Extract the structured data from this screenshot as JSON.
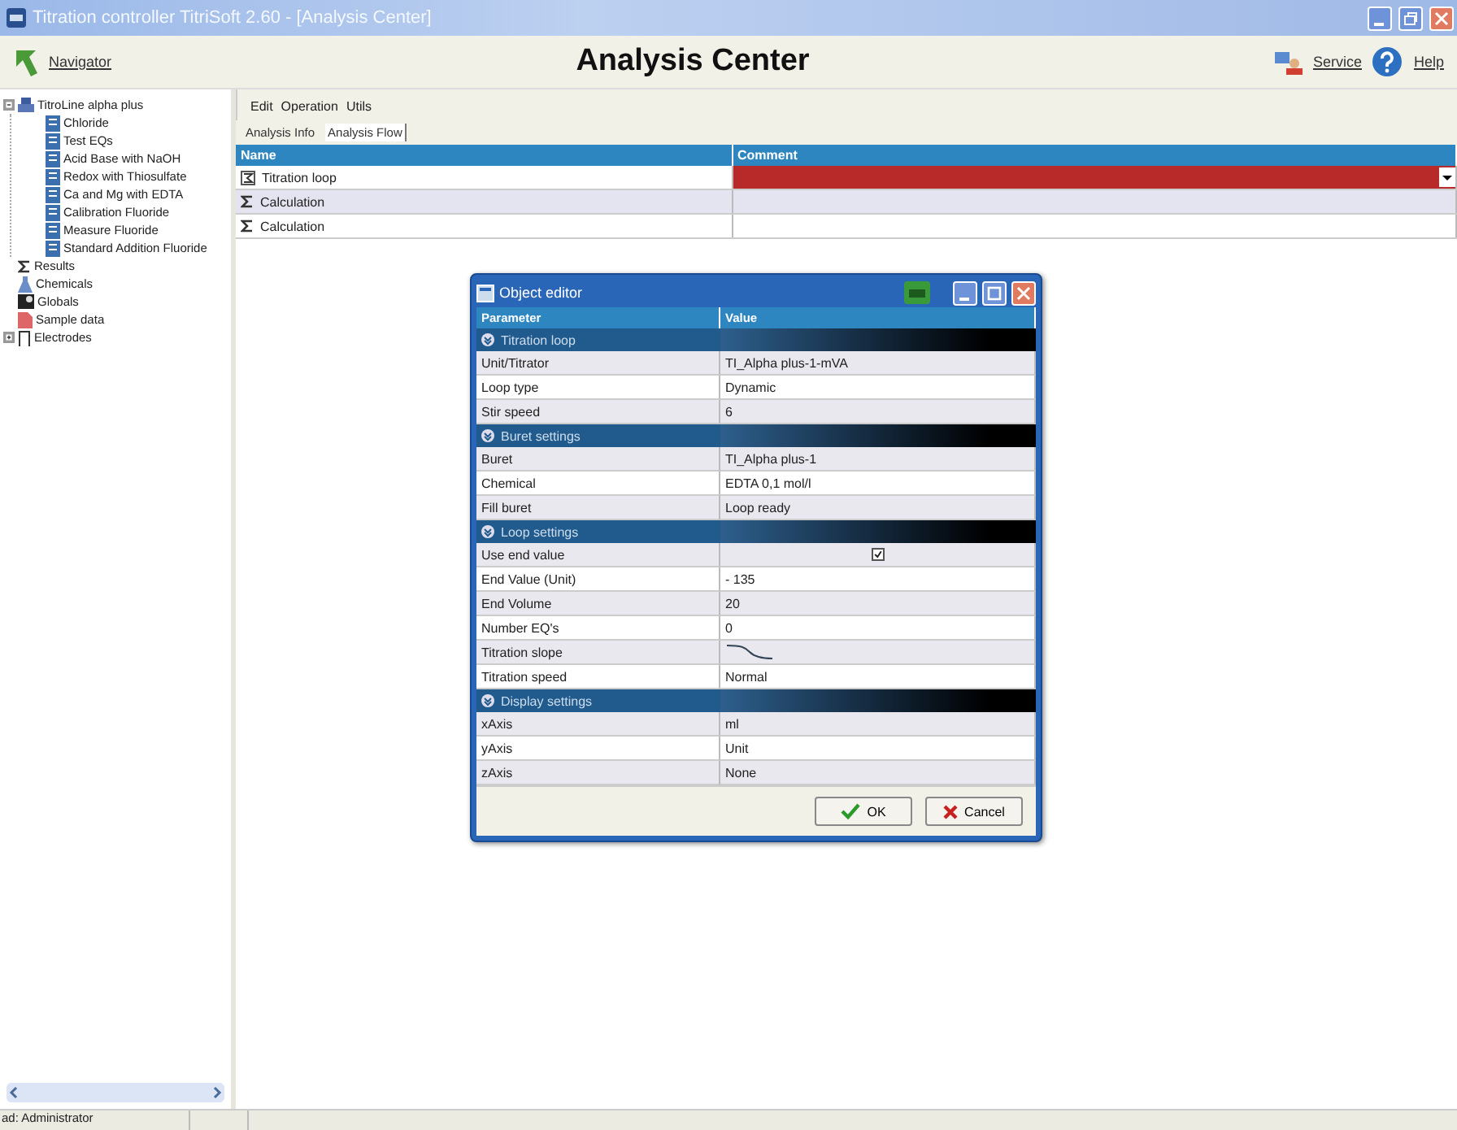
{
  "window": {
    "title": "Titration controller TitriSoft 2.60 - [Analysis Center]"
  },
  "header": {
    "navigator": "Navigator",
    "title": "Analysis Center",
    "service": "Service",
    "help": "Help"
  },
  "tree": [
    {
      "label": "TitroLine alpha plus",
      "kind": "device",
      "expanded": true,
      "children": [
        {
          "label": "Chloride",
          "kind": "method"
        },
        {
          "label": "Test EQs",
          "kind": "method"
        },
        {
          "label": "Acid Base with NaOH",
          "kind": "method"
        },
        {
          "label": "Redox with Thiosulfate",
          "kind": "method"
        },
        {
          "label": "Ca and Mg with EDTA",
          "kind": "method"
        },
        {
          "label": "Calibration Fluoride",
          "kind": "method"
        },
        {
          "label": "Measure Fluoride",
          "kind": "method"
        },
        {
          "label": "Standard Addition Fluoride",
          "kind": "method"
        }
      ]
    },
    {
      "label": "Results",
      "kind": "sigma"
    },
    {
      "label": "Chemicals",
      "kind": "flask"
    },
    {
      "label": "Globals",
      "kind": "globe"
    },
    {
      "label": "Sample data",
      "kind": "sample"
    },
    {
      "label": "Electrodes",
      "kind": "electrode",
      "expanded": false
    }
  ],
  "menu": [
    "Edit",
    "Operation",
    "Utils"
  ],
  "tabs": [
    {
      "label": "Analysis Info",
      "selected": false
    },
    {
      "label": "Analysis Flow",
      "selected": true
    }
  ],
  "table": {
    "columns": [
      "Name",
      "Comment"
    ],
    "rows": [
      {
        "name": "Titration loop",
        "kind": "loop",
        "editing": true
      },
      {
        "name": "Calculation",
        "kind": "sigma",
        "editing": false
      },
      {
        "name": "Calculation",
        "kind": "sigma",
        "editing": false
      }
    ]
  },
  "dialog": {
    "title": "Object editor",
    "columns": [
      "Parameter",
      "Value"
    ],
    "sections": [
      {
        "title": "Titration loop",
        "rows": [
          {
            "parameter": "Unit/Titrator",
            "kind": "text",
            "value": "TI_Alpha plus-1-mVA"
          },
          {
            "parameter": "Loop type",
            "kind": "text",
            "value": "Dynamic"
          },
          {
            "parameter": "Stir speed",
            "kind": "text",
            "value": "6"
          }
        ]
      },
      {
        "title": "Buret settings",
        "rows": [
          {
            "parameter": "Buret",
            "kind": "text",
            "value": "TI_Alpha plus-1"
          },
          {
            "parameter": "Chemical",
            "kind": "text",
            "value": "EDTA 0,1 mol/l"
          },
          {
            "parameter": "Fill buret",
            "kind": "text",
            "value": "Loop ready"
          }
        ]
      },
      {
        "title": "Loop settings",
        "rows": [
          {
            "parameter": "Use end value",
            "kind": "checkbox",
            "checked": true
          },
          {
            "parameter": "End Value (Unit)",
            "kind": "text",
            "value": "- 135"
          },
          {
            "parameter": "End Volume",
            "kind": "text",
            "value": "20"
          },
          {
            "parameter": "Number EQ's",
            "kind": "text",
            "value": "0"
          },
          {
            "parameter": "Titration slope",
            "kind": "slope"
          },
          {
            "parameter": "Titration speed",
            "kind": "text",
            "value": "Normal"
          }
        ]
      },
      {
        "title": "Display settings",
        "rows": [
          {
            "parameter": "xAxis",
            "kind": "text",
            "value": "ml"
          },
          {
            "parameter": "yAxis",
            "kind": "text",
            "value": "Unit"
          },
          {
            "parameter": "zAxis",
            "kind": "text",
            "value": "None"
          }
        ]
      }
    ],
    "buttons": [
      {
        "label": "OK",
        "kind": "ok"
      },
      {
        "label": "Cancel",
        "kind": "cancel"
      }
    ]
  },
  "status_bar": [
    "ad: Administrator"
  ]
}
